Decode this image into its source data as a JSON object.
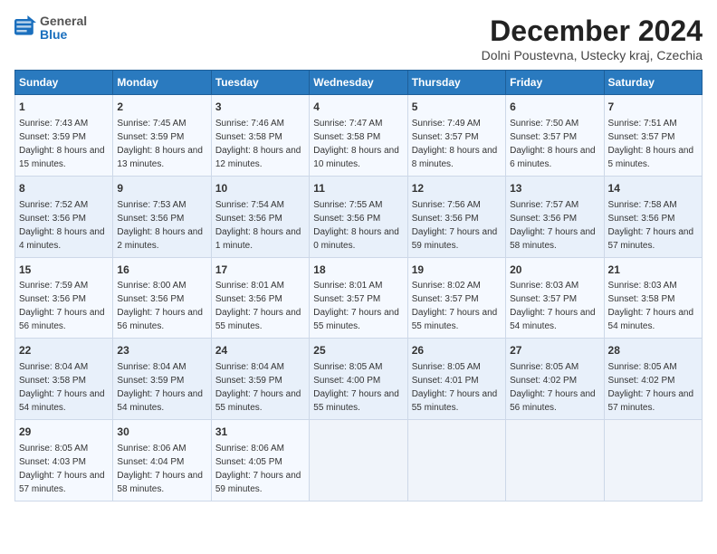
{
  "header": {
    "logo_general": "General",
    "logo_blue": "Blue",
    "title": "December 2024",
    "location": "Dolni Poustevna, Ustecky kraj, Czechia"
  },
  "weekdays": [
    "Sunday",
    "Monday",
    "Tuesday",
    "Wednesday",
    "Thursday",
    "Friday",
    "Saturday"
  ],
  "weeks": [
    [
      {
        "day": "1",
        "sunrise": "7:43 AM",
        "sunset": "3:59 PM",
        "daylight": "8 hours and 15 minutes"
      },
      {
        "day": "2",
        "sunrise": "7:45 AM",
        "sunset": "3:59 PM",
        "daylight": "8 hours and 13 minutes"
      },
      {
        "day": "3",
        "sunrise": "7:46 AM",
        "sunset": "3:58 PM",
        "daylight": "8 hours and 12 minutes"
      },
      {
        "day": "4",
        "sunrise": "7:47 AM",
        "sunset": "3:58 PM",
        "daylight": "8 hours and 10 minutes"
      },
      {
        "day": "5",
        "sunrise": "7:49 AM",
        "sunset": "3:57 PM",
        "daylight": "8 hours and 8 minutes"
      },
      {
        "day": "6",
        "sunrise": "7:50 AM",
        "sunset": "3:57 PM",
        "daylight": "8 hours and 6 minutes"
      },
      {
        "day": "7",
        "sunrise": "7:51 AM",
        "sunset": "3:57 PM",
        "daylight": "8 hours and 5 minutes"
      }
    ],
    [
      {
        "day": "8",
        "sunrise": "7:52 AM",
        "sunset": "3:56 PM",
        "daylight": "8 hours and 4 minutes"
      },
      {
        "day": "9",
        "sunrise": "7:53 AM",
        "sunset": "3:56 PM",
        "daylight": "8 hours and 2 minutes"
      },
      {
        "day": "10",
        "sunrise": "7:54 AM",
        "sunset": "3:56 PM",
        "daylight": "8 hours and 1 minute"
      },
      {
        "day": "11",
        "sunrise": "7:55 AM",
        "sunset": "3:56 PM",
        "daylight": "8 hours and 0 minutes"
      },
      {
        "day": "12",
        "sunrise": "7:56 AM",
        "sunset": "3:56 PM",
        "daylight": "7 hours and 59 minutes"
      },
      {
        "day": "13",
        "sunrise": "7:57 AM",
        "sunset": "3:56 PM",
        "daylight": "7 hours and 58 minutes"
      },
      {
        "day": "14",
        "sunrise": "7:58 AM",
        "sunset": "3:56 PM",
        "daylight": "7 hours and 57 minutes"
      }
    ],
    [
      {
        "day": "15",
        "sunrise": "7:59 AM",
        "sunset": "3:56 PM",
        "daylight": "7 hours and 56 minutes"
      },
      {
        "day": "16",
        "sunrise": "8:00 AM",
        "sunset": "3:56 PM",
        "daylight": "7 hours and 56 minutes"
      },
      {
        "day": "17",
        "sunrise": "8:01 AM",
        "sunset": "3:56 PM",
        "daylight": "7 hours and 55 minutes"
      },
      {
        "day": "18",
        "sunrise": "8:01 AM",
        "sunset": "3:57 PM",
        "daylight": "7 hours and 55 minutes"
      },
      {
        "day": "19",
        "sunrise": "8:02 AM",
        "sunset": "3:57 PM",
        "daylight": "7 hours and 55 minutes"
      },
      {
        "day": "20",
        "sunrise": "8:03 AM",
        "sunset": "3:57 PM",
        "daylight": "7 hours and 54 minutes"
      },
      {
        "day": "21",
        "sunrise": "8:03 AM",
        "sunset": "3:58 PM",
        "daylight": "7 hours and 54 minutes"
      }
    ],
    [
      {
        "day": "22",
        "sunrise": "8:04 AM",
        "sunset": "3:58 PM",
        "daylight": "7 hours and 54 minutes"
      },
      {
        "day": "23",
        "sunrise": "8:04 AM",
        "sunset": "3:59 PM",
        "daylight": "7 hours and 54 minutes"
      },
      {
        "day": "24",
        "sunrise": "8:04 AM",
        "sunset": "3:59 PM",
        "daylight": "7 hours and 55 minutes"
      },
      {
        "day": "25",
        "sunrise": "8:05 AM",
        "sunset": "4:00 PM",
        "daylight": "7 hours and 55 minutes"
      },
      {
        "day": "26",
        "sunrise": "8:05 AM",
        "sunset": "4:01 PM",
        "daylight": "7 hours and 55 minutes"
      },
      {
        "day": "27",
        "sunrise": "8:05 AM",
        "sunset": "4:02 PM",
        "daylight": "7 hours and 56 minutes"
      },
      {
        "day": "28",
        "sunrise": "8:05 AM",
        "sunset": "4:02 PM",
        "daylight": "7 hours and 57 minutes"
      }
    ],
    [
      {
        "day": "29",
        "sunrise": "8:05 AM",
        "sunset": "4:03 PM",
        "daylight": "7 hours and 57 minutes"
      },
      {
        "day": "30",
        "sunrise": "8:06 AM",
        "sunset": "4:04 PM",
        "daylight": "7 hours and 58 minutes"
      },
      {
        "day": "31",
        "sunrise": "8:06 AM",
        "sunset": "4:05 PM",
        "daylight": "7 hours and 59 minutes"
      },
      null,
      null,
      null,
      null
    ]
  ]
}
